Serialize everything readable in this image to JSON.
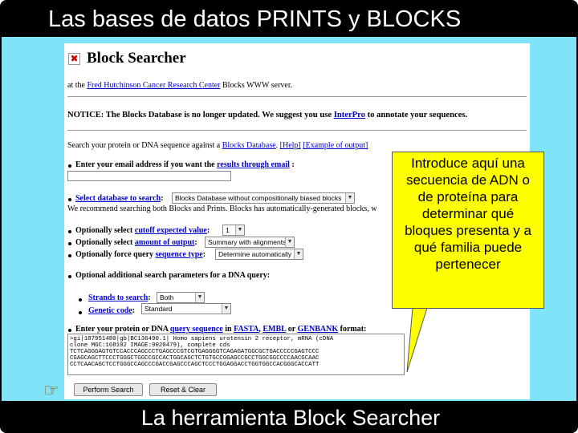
{
  "slide": {
    "title": "Las bases de datos PRINTS y BLOCKS",
    "footer": "La herramienta Block Searcher"
  },
  "page": {
    "title": "Block Searcher",
    "intro_prefix": "at the ",
    "intro_link": "Fred Hutchinson Cancer Research Center",
    "intro_suffix": " Blocks WWW server.",
    "notice_prefix": "NOTICE: The Blocks Database is no longer updated. We suggest you use ",
    "notice_link": "InterPro",
    "notice_suffix": " to annotate your sequences.",
    "search_prefix": "Search your protein or DNA sequence against a ",
    "search_link": "Blocks Database",
    "search_mid": ". [",
    "help_link": "[Help]",
    "example_link": "[Example of output]",
    "email_prefix": "Enter your email address if you want the ",
    "email_link": "results through email",
    "email_suffix": " :",
    "email_value": "",
    "db_link": "Select database to search",
    "db_colon": ":",
    "db_selected": "Blocks Database without compositionally biased blocks",
    "db_recommend": "We recommend searching both Blocks and Prints. Blocks has automatically-generated blocks, w",
    "cutoff_prefix": "Optionally select ",
    "cutoff_link": "cutoff expected value",
    "cutoff_selected": "1",
    "amount_prefix": "Optionally select ",
    "amount_link": "amount of output",
    "amount_selected": "Summary with alignments",
    "qtype_prefix": "Optionally force query ",
    "qtype_link": "sequence type",
    "qtype_selected": "Determine automatically",
    "dna_header": "Optional additional search parameters for a DNA query:",
    "strands_link": "Strands to search",
    "strands_selected": "Both",
    "gcode_link": "Genetic code",
    "gcode_selected": "Standard",
    "seq_prefix": "Enter your protein or DNA ",
    "seq_link": "query sequence",
    "seq_in": " in ",
    "fasta_link": "FASTA",
    "embl_link": "EMBL",
    "genbank_link": "GENBANK",
    "seq_suffix": " format:",
    "sequence_text": ">gi|187951480|gb|BC136490.1| Homo sapiens urotensin 2 receptor, mRNA (cDNA\nclone MGC:168102 IMAGE:9020479), complete cds\nTCTCAGGGAGTGTCCACCCAGCCCTGAGCCCGTCGTGAGGGGTCAGAGATGGCGCTGACCCCCGAGTCCC\nCGAGCAGCTTCCCTGGGCTGGCCGCCACTGGCAGCTCTGTGCCGGAGCCGCCTGGCGGCCCCAACGCAAC\nCCTCAACAGCTCCTGGGCCAGCCCGACCGAGCCCAGCTCCCTGGAGGACCTGGTGGCCACGGGCACCATT",
    "perform_label": "Perform Search",
    "reset_label": "Reset & Clear"
  },
  "callout": {
    "text": "Introduce aquí una secuencia de ADN o de proteína para determinar qué bloques presenta y a qué familia puede pertenecer"
  },
  "icons": {
    "close": "close-icon",
    "pointer": "pointing-hand-icon"
  },
  "colors": {
    "background": "#7fe4f7",
    "title_bar": "#000000",
    "link": "#0000cc",
    "callout": "#ffff00"
  }
}
